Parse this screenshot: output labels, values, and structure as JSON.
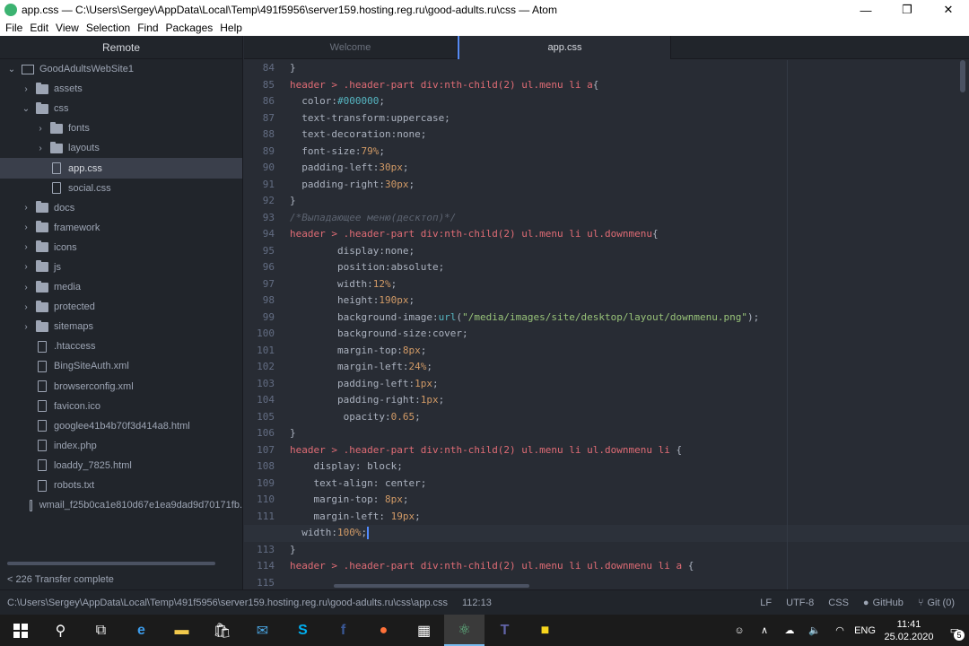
{
  "window": {
    "title": "app.css — C:\\Users\\Sergey\\AppData\\Local\\Temp\\491f5956\\server159.hosting.reg.ru\\good-adults.ru\\css — Atom",
    "minimize_glyph": "—",
    "maximize_glyph": "❐",
    "close_glyph": "✕"
  },
  "menu": [
    "File",
    "Edit",
    "View",
    "Selection",
    "Find",
    "Packages",
    "Help"
  ],
  "sidebar": {
    "title": "Remote",
    "tree": [
      {
        "label": "GoodAdultsWebSite1",
        "type": "root",
        "level": 0,
        "chevron": "down"
      },
      {
        "label": "assets",
        "type": "folder",
        "level": 1,
        "chevron": "right"
      },
      {
        "label": "css",
        "type": "folder",
        "level": 1,
        "chevron": "down"
      },
      {
        "label": "fonts",
        "type": "folder",
        "level": 2,
        "chevron": "right"
      },
      {
        "label": "layouts",
        "type": "folder",
        "level": 2,
        "chevron": "right"
      },
      {
        "label": "app.css",
        "type": "file",
        "level": 2,
        "selected": true
      },
      {
        "label": "social.css",
        "type": "file",
        "level": 2
      },
      {
        "label": "docs",
        "type": "folder",
        "level": 1,
        "chevron": "right"
      },
      {
        "label": "framework",
        "type": "folder",
        "level": 1,
        "chevron": "right"
      },
      {
        "label": "icons",
        "type": "folder",
        "level": 1,
        "chevron": "right"
      },
      {
        "label": "js",
        "type": "folder",
        "level": 1,
        "chevron": "right"
      },
      {
        "label": "media",
        "type": "folder",
        "level": 1,
        "chevron": "right"
      },
      {
        "label": "protected",
        "type": "folder",
        "level": 1,
        "chevron": "right"
      },
      {
        "label": "sitemaps",
        "type": "folder",
        "level": 1,
        "chevron": "right"
      },
      {
        "label": ".htaccess",
        "type": "file",
        "level": 1
      },
      {
        "label": "BingSiteAuth.xml",
        "type": "file",
        "level": 1
      },
      {
        "label": "browserconfig.xml",
        "type": "file",
        "level": 1
      },
      {
        "label": "favicon.ico",
        "type": "file",
        "level": 1
      },
      {
        "label": "googlee41b4b70f3d414a8.html",
        "type": "file",
        "level": 1
      },
      {
        "label": "index.php",
        "type": "file",
        "level": 1
      },
      {
        "label": "loaddy_7825.html",
        "type": "file",
        "level": 1
      },
      {
        "label": "robots.txt",
        "type": "file",
        "level": 1
      },
      {
        "label": "wmail_f25b0ca1e810d67e1ea9dad9d70171fb.",
        "type": "file",
        "level": 1
      }
    ],
    "transfer_status": "< 226 Transfer complete"
  },
  "tabs": [
    {
      "label": "Welcome",
      "active": false
    },
    {
      "label": "app.css",
      "active": true
    }
  ],
  "editor": {
    "current_line": 112,
    "lines": [
      {
        "n": 84,
        "tokens": [
          [
            "",
            "}"
          ]
        ]
      },
      {
        "n": 85,
        "tokens": [
          [
            "t",
            "header"
          ],
          [
            "",
            " "
          ],
          [
            "t",
            ">"
          ],
          [
            "",
            " "
          ],
          [
            "t",
            ".header-part div:nth-child(2) ul.menu li a"
          ],
          [
            "",
            "{"
          ]
        ]
      },
      {
        "n": 86,
        "tokens": [
          [
            "",
            "  "
          ],
          [
            "",
            "color:"
          ],
          [
            "p",
            "#000000"
          ],
          [
            "",
            ";"
          ]
        ]
      },
      {
        "n": 87,
        "tokens": [
          [
            "",
            "  text-transform:uppercase;"
          ]
        ]
      },
      {
        "n": 88,
        "tokens": [
          [
            "",
            "  text-decoration:none;"
          ]
        ]
      },
      {
        "n": 89,
        "tokens": [
          [
            "",
            "  font-size:"
          ],
          [
            "s",
            "79%"
          ],
          [
            "",
            ";"
          ]
        ]
      },
      {
        "n": 90,
        "tokens": [
          [
            "",
            "  padding-left:"
          ],
          [
            "s",
            "30px"
          ],
          [
            "",
            ";"
          ]
        ]
      },
      {
        "n": 91,
        "tokens": [
          [
            "",
            "  padding-right:"
          ],
          [
            "s",
            "30px"
          ],
          [
            "",
            ";"
          ]
        ]
      },
      {
        "n": 92,
        "tokens": [
          [
            "",
            "}"
          ]
        ]
      },
      {
        "n": 93,
        "tokens": [
          [
            "c",
            "/*Выпадающее меню(десктоп)*/"
          ]
        ]
      },
      {
        "n": 94,
        "tokens": [
          [
            "t",
            "header"
          ],
          [
            "",
            " "
          ],
          [
            "t",
            ">"
          ],
          [
            "",
            " "
          ],
          [
            "t",
            ".header-part div:nth-child(2) ul.menu li ul.downmenu"
          ],
          [
            "",
            "{"
          ]
        ]
      },
      {
        "n": 95,
        "tokens": [
          [
            "",
            "        display:none;"
          ]
        ]
      },
      {
        "n": 96,
        "tokens": [
          [
            "",
            "        position:absolute;"
          ]
        ]
      },
      {
        "n": 97,
        "tokens": [
          [
            "",
            "        width:"
          ],
          [
            "s",
            "12%"
          ],
          [
            "",
            ";"
          ]
        ]
      },
      {
        "n": 98,
        "tokens": [
          [
            "",
            "        height:"
          ],
          [
            "s",
            "190px"
          ],
          [
            "",
            ";"
          ]
        ]
      },
      {
        "n": 99,
        "tokens": [
          [
            "",
            "        background-image:"
          ],
          [
            "p",
            "url"
          ],
          [
            "",
            "("
          ],
          [
            "str",
            "\"/media/images/site/desktop/layout/downmenu.png\""
          ],
          [
            "",
            ");"
          ]
        ]
      },
      {
        "n": 100,
        "tokens": [
          [
            "",
            "        background-size:cover;"
          ]
        ]
      },
      {
        "n": 101,
        "tokens": [
          [
            "",
            "        margin-top:"
          ],
          [
            "s",
            "8px"
          ],
          [
            "",
            ";"
          ]
        ]
      },
      {
        "n": 102,
        "tokens": [
          [
            "",
            "        margin-left:"
          ],
          [
            "s",
            "24%"
          ],
          [
            "",
            ";"
          ]
        ]
      },
      {
        "n": 103,
        "tokens": [
          [
            "",
            "        padding-left:"
          ],
          [
            "s",
            "1px"
          ],
          [
            "",
            ";"
          ]
        ]
      },
      {
        "n": 104,
        "tokens": [
          [
            "",
            "        padding-right:"
          ],
          [
            "s",
            "1px"
          ],
          [
            "",
            ";"
          ]
        ]
      },
      {
        "n": 105,
        "tokens": [
          [
            "",
            "         opacity:"
          ],
          [
            "s",
            "0.65"
          ],
          [
            "",
            ";"
          ]
        ]
      },
      {
        "n": 106,
        "tokens": [
          [
            "",
            "}"
          ]
        ]
      },
      {
        "n": 107,
        "tokens": [
          [
            "t",
            "header"
          ],
          [
            "",
            " "
          ],
          [
            "t",
            ">"
          ],
          [
            "",
            " "
          ],
          [
            "t",
            ".header-part div:nth-child(2) ul.menu li ul.downmenu li"
          ],
          [
            "",
            " {"
          ]
        ]
      },
      {
        "n": 108,
        "tokens": [
          [
            "",
            "    display: block;"
          ]
        ]
      },
      {
        "n": 109,
        "tokens": [
          [
            "",
            "    text-align: center;"
          ]
        ]
      },
      {
        "n": 110,
        "tokens": [
          [
            "",
            "    margin-top: "
          ],
          [
            "s",
            "8px"
          ],
          [
            "",
            ";"
          ]
        ]
      },
      {
        "n": 111,
        "tokens": [
          [
            "",
            "    margin-left: "
          ],
          [
            "s",
            "19px"
          ],
          [
            "",
            ";"
          ]
        ]
      },
      {
        "n": 112,
        "tokens": [
          [
            "",
            "  width:"
          ],
          [
            "s",
            "100%"
          ],
          [
            "",
            ";"
          ]
        ]
      },
      {
        "n": 113,
        "tokens": [
          [
            "",
            "}"
          ]
        ]
      },
      {
        "n": 114,
        "tokens": [
          [
            "t",
            "header"
          ],
          [
            "",
            " "
          ],
          [
            "t",
            ">"
          ],
          [
            "",
            " "
          ],
          [
            "t",
            ".header-part div:nth-child(2) ul.menu li ul.downmenu li a"
          ],
          [
            "",
            " {"
          ]
        ]
      },
      {
        "n": 115,
        "tokens": [
          [
            "",
            ""
          ]
        ]
      }
    ]
  },
  "statusbar": {
    "path": "C:\\Users\\Sergey\\AppData\\Local\\Temp\\491f5956\\server159.hosting.reg.ru\\good-adults.ru\\css\\app.css",
    "cursor_pos": "112:13",
    "line_ending": "LF",
    "encoding": "UTF-8",
    "grammar": "CSS",
    "github": "GitHub",
    "git": "Git (0)"
  },
  "taskbar": {
    "lang": "ENG",
    "time": "11:41",
    "date": "25.02.2020",
    "notifications": "5"
  },
  "colors": {
    "accent": "#568af2",
    "selector": "#e06c75",
    "property_value_color": "#56b6c2",
    "number": "#d19a66",
    "string": "#98c379",
    "comment": "#5c6370"
  }
}
